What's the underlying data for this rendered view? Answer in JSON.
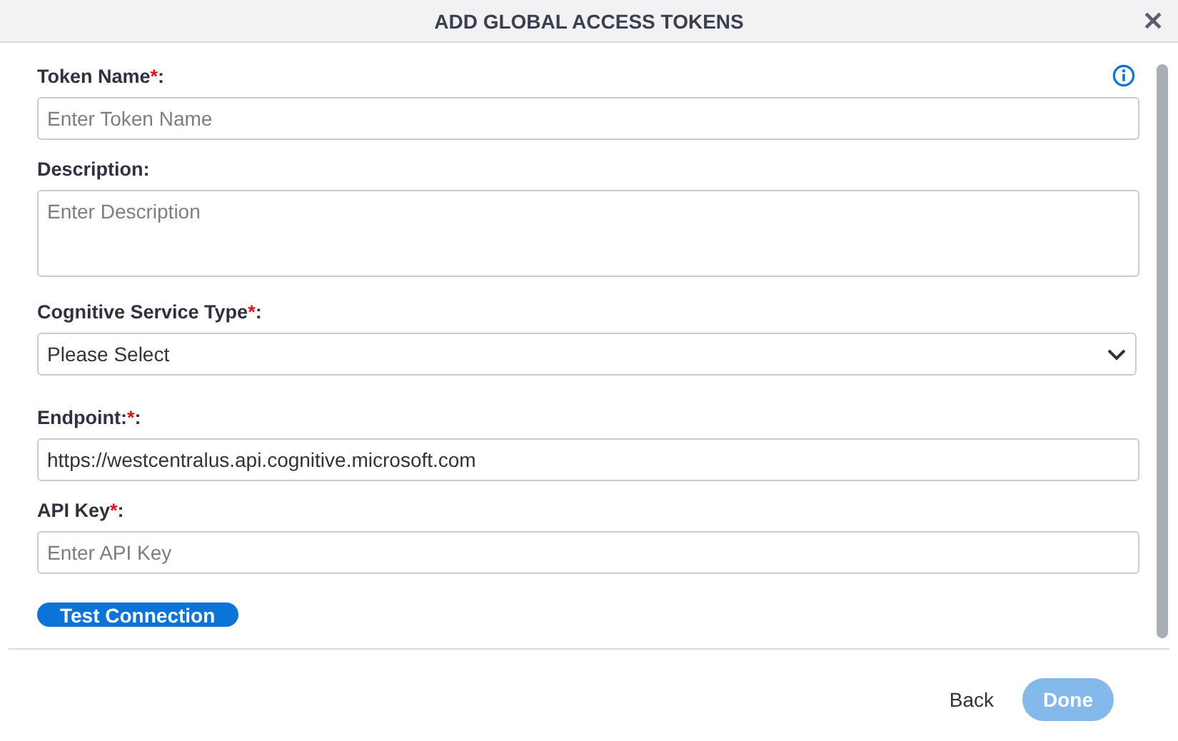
{
  "window": {
    "title": "ADD GLOBAL ACCESS TOKENS",
    "close": "✕"
  },
  "fields": [
    {
      "kind": "text",
      "label": "Token Name",
      "required": "*",
      "colon": ":",
      "placeholder": "Enter Token Name",
      "info": true
    },
    {
      "kind": "textarea",
      "label": "Description:",
      "placeholder": "Enter Description"
    },
    {
      "kind": "select",
      "label": "Cognitive Service Type",
      "required": "*",
      "colon": ":",
      "value": "Please Select"
    },
    {
      "kind": "text",
      "label": "Endpoint:",
      "required": "*",
      "colon": ":",
      "value": "https://westcentralus.api.cognitive.microsoft.com"
    },
    {
      "kind": "text",
      "label": "API Key",
      "required": "*",
      "colon": ":",
      "placeholder": "Enter API Key"
    }
  ],
  "test_button": {
    "label": "Test Connection"
  },
  "footer": {
    "back": "Back",
    "done": {
      "label": "Done",
      "disabled": true
    }
  }
}
